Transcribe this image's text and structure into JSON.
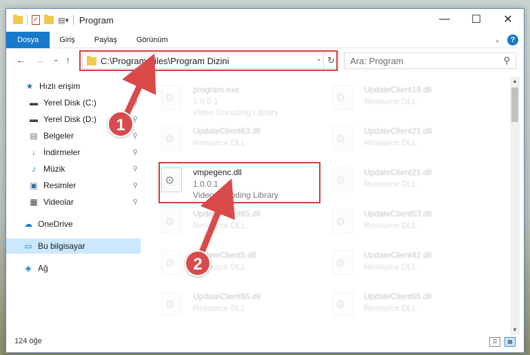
{
  "window": {
    "title": "Program"
  },
  "window_controls": {
    "minimize": "—",
    "maximize": "☐",
    "close": "✕"
  },
  "ribbon": {
    "tabs": [
      "Dosya",
      "Giriş",
      "Paylaş",
      "Görünüm"
    ],
    "expand": "⌄",
    "help": "?"
  },
  "nav": {
    "back": "←",
    "forward": "→",
    "recent": "⌄",
    "up": "↑"
  },
  "address": {
    "path": "C:\\Program Files\\Program Dizini",
    "refresh": "↻",
    "dropdown": "⌄"
  },
  "search": {
    "placeholder": "Ara: Program",
    "icon": "⚲"
  },
  "sidebar": {
    "items": [
      {
        "label": "Hızlı erişim",
        "icon": "★",
        "pinned": false
      },
      {
        "label": "Yerel Disk (C:)",
        "icon": "▬",
        "pinned": true
      },
      {
        "label": "Yerel Disk (D:)",
        "icon": "▬",
        "pinned": true
      },
      {
        "label": "Belgeler",
        "icon": "▤",
        "pinned": true
      },
      {
        "label": "İndirmeler",
        "icon": "↓",
        "pinned": true
      },
      {
        "label": "Müzik",
        "icon": "♪",
        "pinned": true
      },
      {
        "label": "Resimler",
        "icon": "▣",
        "pinned": true
      },
      {
        "label": "Videolar",
        "icon": "▦",
        "pinned": true
      },
      {
        "label": "OneDrive",
        "icon": "☁",
        "pinned": false
      },
      {
        "label": "Bu bilgisayar",
        "icon": "▭",
        "pinned": false
      },
      {
        "label": "Ağ",
        "icon": "◈",
        "pinned": false
      }
    ],
    "pin_glyph": "📌"
  },
  "files": {
    "left": [
      {
        "name": "program.exe",
        "l2": "1.0.0.1",
        "l3": "Video Encoding Library"
      },
      {
        "name": "UpdateClient63.dll",
        "l2": "Resource DLL",
        "l3": ""
      },
      {
        "name": "vmpegenc.dll",
        "l2": "1.0.0.1",
        "l3": "Video Encoding Library"
      },
      {
        "name": "UpdateClient65.dll",
        "l2": "Resource DLL",
        "l3": ""
      },
      {
        "name": "UpdateClient5.dll",
        "l2": "Resource DLL",
        "l3": ""
      },
      {
        "name": "UpdateClient65.dll",
        "l2": "Resource DLL",
        "l3": ""
      }
    ],
    "right": [
      {
        "name": "UpdateClient19.dll",
        "l2": "Resource DLL",
        "l3": ""
      },
      {
        "name": "UpdateClient21.dll",
        "l2": "Resource DLL",
        "l3": ""
      },
      {
        "name": "UpdateClient21.dll",
        "l2": "Resource DLL",
        "l3": ""
      },
      {
        "name": "UpdateClient63.dll",
        "l2": "Resource DLL",
        "l3": ""
      },
      {
        "name": "UpdateClient42.dll",
        "l2": "Resource DLL",
        "l3": ""
      },
      {
        "name": "UpdateClient65.dll",
        "l2": "Resource DLL",
        "l3": ""
      }
    ]
  },
  "scrollbar": {
    "up": "▲",
    "down": "▼"
  },
  "status": {
    "count": "124 öğe"
  },
  "view": {
    "details": "☰",
    "tiles": "▦"
  },
  "annotations": {
    "step1": "1",
    "step2": "2",
    "color": "#d94a4a"
  }
}
